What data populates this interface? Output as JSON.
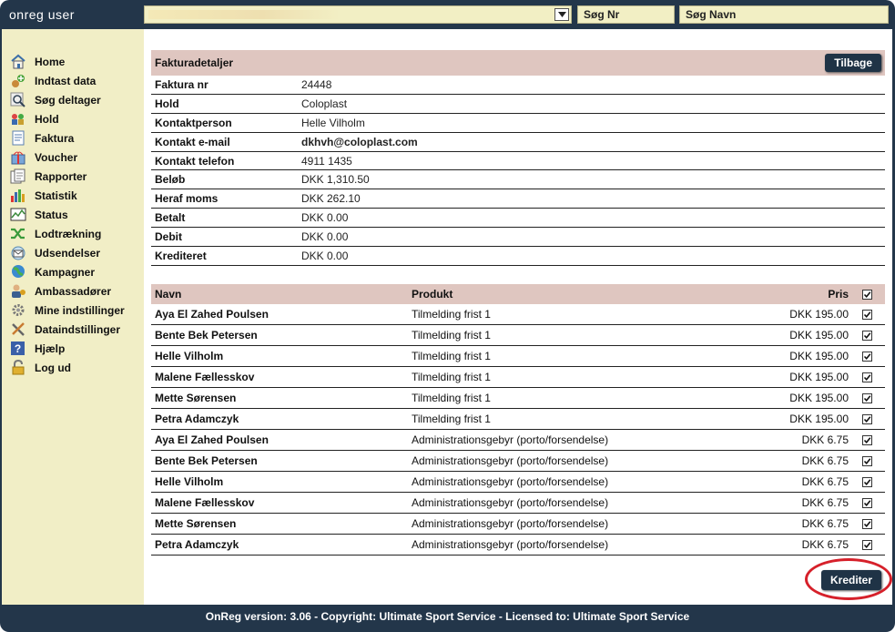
{
  "app": {
    "title": "onreg user"
  },
  "search": {
    "nr_label": "Søg Nr",
    "name_label": "Søg Navn"
  },
  "sidebar": {
    "items": [
      {
        "label": "Home",
        "icon": "house-icon"
      },
      {
        "label": "Indtast data",
        "icon": "add-data-icon"
      },
      {
        "label": "Søg deltager",
        "icon": "search-participant-icon"
      },
      {
        "label": "Hold",
        "icon": "team-icon"
      },
      {
        "label": "Faktura",
        "icon": "invoice-icon"
      },
      {
        "label": "Voucher",
        "icon": "gift-icon"
      },
      {
        "label": "Rapporter",
        "icon": "report-icon"
      },
      {
        "label": "Statistik",
        "icon": "bar-chart-icon"
      },
      {
        "label": "Status",
        "icon": "status-chart-icon"
      },
      {
        "label": "Lodtrækning",
        "icon": "shuffle-icon"
      },
      {
        "label": "Udsendelser",
        "icon": "mail-icon"
      },
      {
        "label": "Kampagner",
        "icon": "globe-icon"
      },
      {
        "label": "Ambassadører",
        "icon": "ambassador-icon"
      },
      {
        "label": "Mine indstillinger",
        "icon": "gear-icon"
      },
      {
        "label": "Dataindstillinger",
        "icon": "tools-icon"
      },
      {
        "label": "Hjælp",
        "icon": "help-icon"
      },
      {
        "label": "Log ud",
        "icon": "lock-icon"
      }
    ]
  },
  "details": {
    "title": "Fakturadetaljer",
    "back_label": "Tilbage",
    "rows": [
      {
        "key": "Faktura nr",
        "value": "24448"
      },
      {
        "key": "Hold",
        "value": "Coloplast"
      },
      {
        "key": "Kontaktperson",
        "value": "Helle Vilholm"
      },
      {
        "key": "Kontakt e-mail",
        "value": "dkhvh@coloplast.com"
      },
      {
        "key": "Kontakt telefon",
        "value": "4911 1435"
      },
      {
        "key": "Beløb",
        "value": "DKK 1,310.50"
      },
      {
        "key": "Heraf moms",
        "value": "DKK 262.10"
      },
      {
        "key": "Betalt",
        "value": "DKK 0.00"
      },
      {
        "key": "Debit",
        "value": "DKK 0.00"
      },
      {
        "key": "Krediteret",
        "value": "DKK 0.00"
      }
    ]
  },
  "lines": {
    "headers": {
      "name": "Navn",
      "product": "Produkt",
      "price": "Pris"
    },
    "rows": [
      {
        "name": "Aya El Zahed Poulsen",
        "product": "Tilmelding frist 1",
        "price": "DKK 195.00",
        "checked": true
      },
      {
        "name": "Bente Bek Petersen",
        "product": "Tilmelding frist 1",
        "price": "DKK 195.00",
        "checked": true
      },
      {
        "name": "Helle Vilholm",
        "product": "Tilmelding frist 1",
        "price": "DKK 195.00",
        "checked": true
      },
      {
        "name": "Malene Fællesskov",
        "product": "Tilmelding frist 1",
        "price": "DKK 195.00",
        "checked": true
      },
      {
        "name": "Mette Sørensen",
        "product": "Tilmelding frist 1",
        "price": "DKK 195.00",
        "checked": true
      },
      {
        "name": "Petra Adamczyk",
        "product": "Tilmelding frist 1",
        "price": "DKK 195.00",
        "checked": true
      },
      {
        "name": "Aya El Zahed Poulsen",
        "product": "Administrationsgebyr (porto/forsendelse)",
        "price": "DKK 6.75",
        "checked": true
      },
      {
        "name": "Bente Bek Petersen",
        "product": "Administrationsgebyr (porto/forsendelse)",
        "price": "DKK 6.75",
        "checked": true
      },
      {
        "name": "Helle Vilholm",
        "product": "Administrationsgebyr (porto/forsendelse)",
        "price": "DKK 6.75",
        "checked": true
      },
      {
        "name": "Malene Fællesskov",
        "product": "Administrationsgebyr (porto/forsendelse)",
        "price": "DKK 6.75",
        "checked": true
      },
      {
        "name": "Mette Sørensen",
        "product": "Administrationsgebyr (porto/forsendelse)",
        "price": "DKK 6.75",
        "checked": true
      },
      {
        "name": "Petra Adamczyk",
        "product": "Administrationsgebyr (porto/forsendelse)",
        "price": "DKK 6.75",
        "checked": true
      }
    ],
    "credit_label": "Krediter"
  },
  "footer": {
    "text": "OnReg version: 3.06 - Copyright: Ultimate Sport Service - Licensed to: Ultimate Sport Service"
  },
  "colors": {
    "frame": "#23364a",
    "sidebar_bg": "#f1eec6",
    "header_bg": "#dfc6c0",
    "button_bg": "#1f3346",
    "annotation_ring": "#d6202a"
  }
}
